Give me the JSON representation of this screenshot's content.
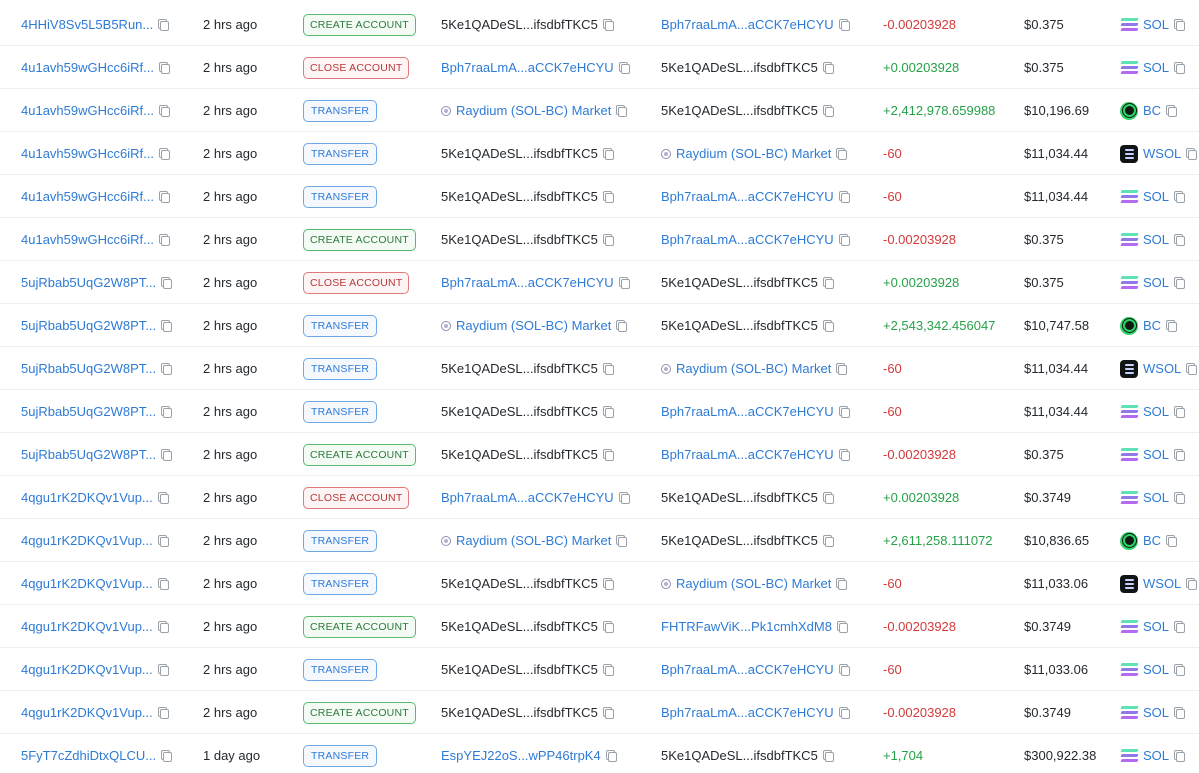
{
  "rows": [
    {
      "sig": "4HHiV8Sv5L5B5Run...",
      "time": "2 hrs ago",
      "action": "CREATE ACCOUNT",
      "action_type": "create",
      "from": "5Ke1QADeSL...ifsdbfTKC5",
      "from_link": false,
      "from_icon": "",
      "to": "Bph7raaLmA...aCCK7eHCYU",
      "to_link": true,
      "to_icon": "",
      "change": "-0.00203928",
      "dir": "neg",
      "value": "$0.375",
      "token": "SOL",
      "token_icon": "sol"
    },
    {
      "sig": "4u1avh59wGHcc6iRf...",
      "time": "2 hrs ago",
      "action": "CLOSE ACCOUNT",
      "action_type": "close",
      "from": "Bph7raaLmA...aCCK7eHCYU",
      "from_link": true,
      "from_icon": "",
      "to": "5Ke1QADeSL...ifsdbfTKC5",
      "to_link": false,
      "to_icon": "",
      "change": "+0.00203928",
      "dir": "pos",
      "value": "$0.375",
      "token": "SOL",
      "token_icon": "sol"
    },
    {
      "sig": "4u1avh59wGHcc6iRf...",
      "time": "2 hrs ago",
      "action": "TRANSFER",
      "action_type": "transfer",
      "from": "Raydium (SOL-BC) Market",
      "from_link": true,
      "from_icon": "raydium",
      "to": "5Ke1QADeSL...ifsdbfTKC5",
      "to_link": false,
      "to_icon": "",
      "change": "+2,412,978.659988",
      "dir": "pos",
      "value": "$10,196.69",
      "token": "BC",
      "token_icon": "bc"
    },
    {
      "sig": "4u1avh59wGHcc6iRf...",
      "time": "2 hrs ago",
      "action": "TRANSFER",
      "action_type": "transfer",
      "from": "5Ke1QADeSL...ifsdbfTKC5",
      "from_link": false,
      "from_icon": "",
      "to": "Raydium (SOL-BC) Market",
      "to_link": true,
      "to_icon": "raydium",
      "change": "-60",
      "dir": "neg",
      "value": "$11,034.44",
      "token": "WSOL",
      "token_icon": "wsol"
    },
    {
      "sig": "4u1avh59wGHcc6iRf...",
      "time": "2 hrs ago",
      "action": "TRANSFER",
      "action_type": "transfer",
      "from": "5Ke1QADeSL...ifsdbfTKC5",
      "from_link": false,
      "from_icon": "",
      "to": "Bph7raaLmA...aCCK7eHCYU",
      "to_link": true,
      "to_icon": "",
      "change": "-60",
      "dir": "neg",
      "value": "$11,034.44",
      "token": "SOL",
      "token_icon": "sol"
    },
    {
      "sig": "4u1avh59wGHcc6iRf...",
      "time": "2 hrs ago",
      "action": "CREATE ACCOUNT",
      "action_type": "create",
      "from": "5Ke1QADeSL...ifsdbfTKC5",
      "from_link": false,
      "from_icon": "",
      "to": "Bph7raaLmA...aCCK7eHCYU",
      "to_link": true,
      "to_icon": "",
      "change": "-0.00203928",
      "dir": "neg",
      "value": "$0.375",
      "token": "SOL",
      "token_icon": "sol"
    },
    {
      "sig": "5ujRbab5UqG2W8PT...",
      "time": "2 hrs ago",
      "action": "CLOSE ACCOUNT",
      "action_type": "close",
      "from": "Bph7raaLmA...aCCK7eHCYU",
      "from_link": true,
      "from_icon": "",
      "to": "5Ke1QADeSL...ifsdbfTKC5",
      "to_link": false,
      "to_icon": "",
      "change": "+0.00203928",
      "dir": "pos",
      "value": "$0.375",
      "token": "SOL",
      "token_icon": "sol"
    },
    {
      "sig": "5ujRbab5UqG2W8PT...",
      "time": "2 hrs ago",
      "action": "TRANSFER",
      "action_type": "transfer",
      "from": "Raydium (SOL-BC) Market",
      "from_link": true,
      "from_icon": "raydium",
      "to": "5Ke1QADeSL...ifsdbfTKC5",
      "to_link": false,
      "to_icon": "",
      "change": "+2,543,342.456047",
      "dir": "pos",
      "value": "$10,747.58",
      "token": "BC",
      "token_icon": "bc"
    },
    {
      "sig": "5ujRbab5UqG2W8PT...",
      "time": "2 hrs ago",
      "action": "TRANSFER",
      "action_type": "transfer",
      "from": "5Ke1QADeSL...ifsdbfTKC5",
      "from_link": false,
      "from_icon": "",
      "to": "Raydium (SOL-BC) Market",
      "to_link": true,
      "to_icon": "raydium",
      "change": "-60",
      "dir": "neg",
      "value": "$11,034.44",
      "token": "WSOL",
      "token_icon": "wsol"
    },
    {
      "sig": "5ujRbab5UqG2W8PT...",
      "time": "2 hrs ago",
      "action": "TRANSFER",
      "action_type": "transfer",
      "from": "5Ke1QADeSL...ifsdbfTKC5",
      "from_link": false,
      "from_icon": "",
      "to": "Bph7raaLmA...aCCK7eHCYU",
      "to_link": true,
      "to_icon": "",
      "change": "-60",
      "dir": "neg",
      "value": "$11,034.44",
      "token": "SOL",
      "token_icon": "sol"
    },
    {
      "sig": "5ujRbab5UqG2W8PT...",
      "time": "2 hrs ago",
      "action": "CREATE ACCOUNT",
      "action_type": "create",
      "from": "5Ke1QADeSL...ifsdbfTKC5",
      "from_link": false,
      "from_icon": "",
      "to": "Bph7raaLmA...aCCK7eHCYU",
      "to_link": true,
      "to_icon": "",
      "change": "-0.00203928",
      "dir": "neg",
      "value": "$0.375",
      "token": "SOL",
      "token_icon": "sol"
    },
    {
      "sig": "4qgu1rK2DKQv1Vup...",
      "time": "2 hrs ago",
      "action": "CLOSE ACCOUNT",
      "action_type": "close",
      "from": "Bph7raaLmA...aCCK7eHCYU",
      "from_link": true,
      "from_icon": "",
      "to": "5Ke1QADeSL...ifsdbfTKC5",
      "to_link": false,
      "to_icon": "",
      "change": "+0.00203928",
      "dir": "pos",
      "value": "$0.3749",
      "token": "SOL",
      "token_icon": "sol"
    },
    {
      "sig": "4qgu1rK2DKQv1Vup...",
      "time": "2 hrs ago",
      "action": "TRANSFER",
      "action_type": "transfer",
      "from": "Raydium (SOL-BC) Market",
      "from_link": true,
      "from_icon": "raydium",
      "to": "5Ke1QADeSL...ifsdbfTKC5",
      "to_link": false,
      "to_icon": "",
      "change": "+2,611,258.111072",
      "dir": "pos",
      "value": "$10,836.65",
      "token": "BC",
      "token_icon": "bc"
    },
    {
      "sig": "4qgu1rK2DKQv1Vup...",
      "time": "2 hrs ago",
      "action": "TRANSFER",
      "action_type": "transfer",
      "from": "5Ke1QADeSL...ifsdbfTKC5",
      "from_link": false,
      "from_icon": "",
      "to": "Raydium (SOL-BC) Market",
      "to_link": true,
      "to_icon": "raydium",
      "change": "-60",
      "dir": "neg",
      "value": "$11,033.06",
      "token": "WSOL",
      "token_icon": "wsol"
    },
    {
      "sig": "4qgu1rK2DKQv1Vup...",
      "time": "2 hrs ago",
      "action": "CREATE ACCOUNT",
      "action_type": "create",
      "from": "5Ke1QADeSL...ifsdbfTKC5",
      "from_link": false,
      "from_icon": "",
      "to": "FHTRFawViK...Pk1cmhXdM8",
      "to_link": true,
      "to_icon": "",
      "change": "-0.00203928",
      "dir": "neg",
      "value": "$0.3749",
      "token": "SOL",
      "token_icon": "sol"
    },
    {
      "sig": "4qgu1rK2DKQv1Vup...",
      "time": "2 hrs ago",
      "action": "TRANSFER",
      "action_type": "transfer",
      "from": "5Ke1QADeSL...ifsdbfTKC5",
      "from_link": false,
      "from_icon": "",
      "to": "Bph7raaLmA...aCCK7eHCYU",
      "to_link": true,
      "to_icon": "",
      "change": "-60",
      "dir": "neg",
      "value": "$11,033.06",
      "token": "SOL",
      "token_icon": "sol"
    },
    {
      "sig": "4qgu1rK2DKQv1Vup...",
      "time": "2 hrs ago",
      "action": "CREATE ACCOUNT",
      "action_type": "create",
      "from": "5Ke1QADeSL...ifsdbfTKC5",
      "from_link": false,
      "from_icon": "",
      "to": "Bph7raaLmA...aCCK7eHCYU",
      "to_link": true,
      "to_icon": "",
      "change": "-0.00203928",
      "dir": "neg",
      "value": "$0.3749",
      "token": "SOL",
      "token_icon": "sol"
    },
    {
      "sig": "5FyT7cZdhiDtxQLCU...",
      "time": "1 day ago",
      "action": "TRANSFER",
      "action_type": "transfer",
      "from": "EspYEJ22oS...wPP46trpK4",
      "from_link": true,
      "from_icon": "",
      "to": "5Ke1QADeSL...ifsdbfTKC5",
      "to_link": false,
      "to_icon": "",
      "change": "+1,704",
      "dir": "pos",
      "value": "$300,922.38",
      "token": "SOL",
      "token_icon": "sol"
    }
  ]
}
